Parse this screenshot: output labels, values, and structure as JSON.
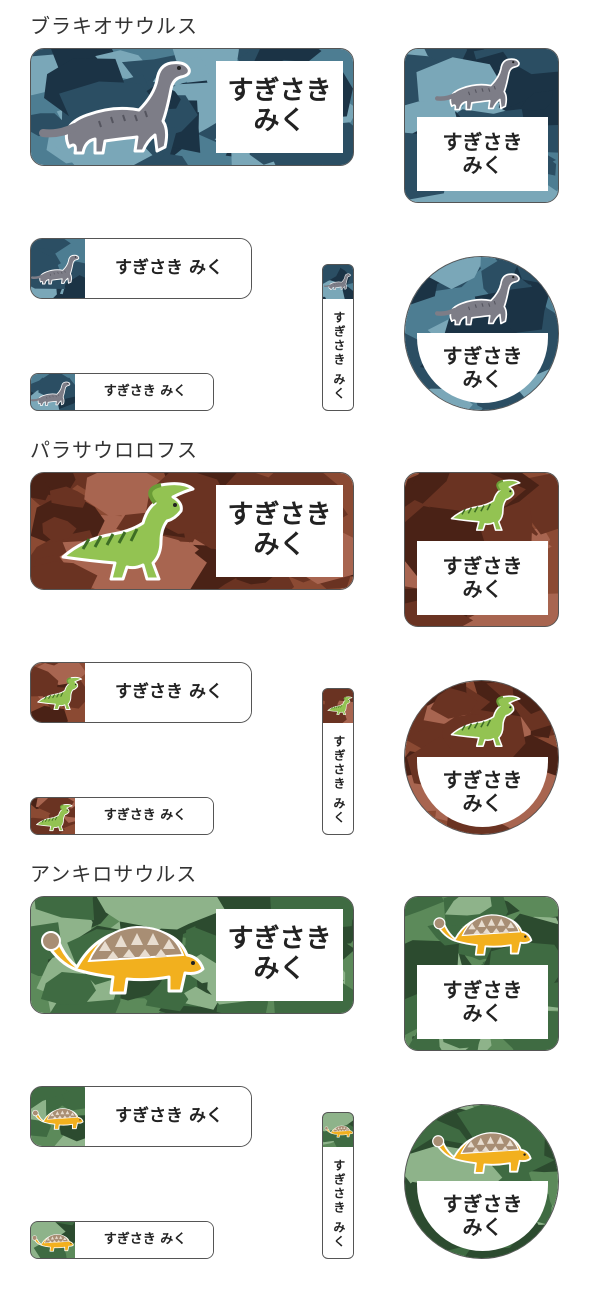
{
  "sections": [
    {
      "title": "ブラキオサウルス",
      "dino": "brachiosaurus",
      "colors": {
        "base": "#4d7d92",
        "c1": "#2b4e63",
        "c2": "#1b3345",
        "c3": "#7aa7b8"
      }
    },
    {
      "title": "パラサウロロフス",
      "dino": "parasaurolophus",
      "colors": {
        "base": "#8b4a33",
        "c1": "#6a3322",
        "c2": "#4a2216",
        "c3": "#a86550"
      }
    },
    {
      "title": "アンキロサウルス",
      "dino": "ankylosaurus",
      "colors": {
        "base": "#5c8a5a",
        "c1": "#3f6b42",
        "c2": "#2c4b2f",
        "c3": "#8eb38a"
      }
    }
  ],
  "name_stacked": "すぎさき\nみく",
  "name_line": "すぎさき みく",
  "name_vertical": "すぎさき みく"
}
